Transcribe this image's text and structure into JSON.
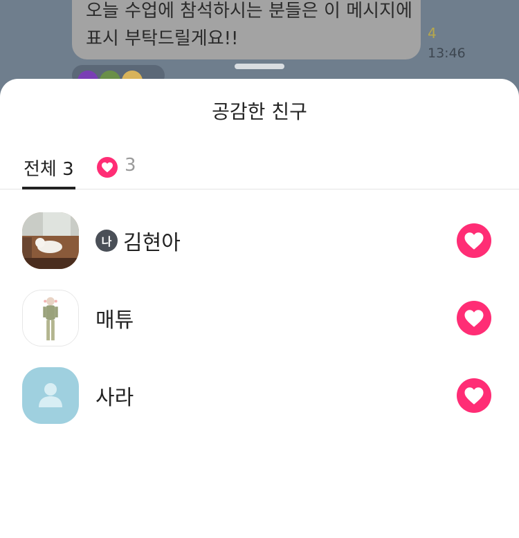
{
  "background_chat": {
    "message_lines": [
      "오늘 수업에 참석하시는 분들은 이 메시지에",
      "표시 부탁드릴게요!!"
    ],
    "unread_count": "4",
    "time": "13:46"
  },
  "sheet": {
    "title": "공감한 친구",
    "tabs": {
      "all_label": "전체 3",
      "heart_count": "3"
    },
    "me_badge": "나",
    "friends": [
      {
        "name": "김현아",
        "is_me": true,
        "avatar": "photo-dog",
        "reaction": "heart-icon"
      },
      {
        "name": "매튜",
        "is_me": false,
        "avatar": "drawing-person",
        "reaction": "heart-icon"
      },
      {
        "name": "사라",
        "is_me": false,
        "avatar": "default-profile",
        "reaction": "heart-icon"
      }
    ]
  },
  "colors": {
    "accent_heart": "#ff2d75",
    "overlay": "#6e7d8c",
    "default_avatar": "#9fd0df"
  }
}
